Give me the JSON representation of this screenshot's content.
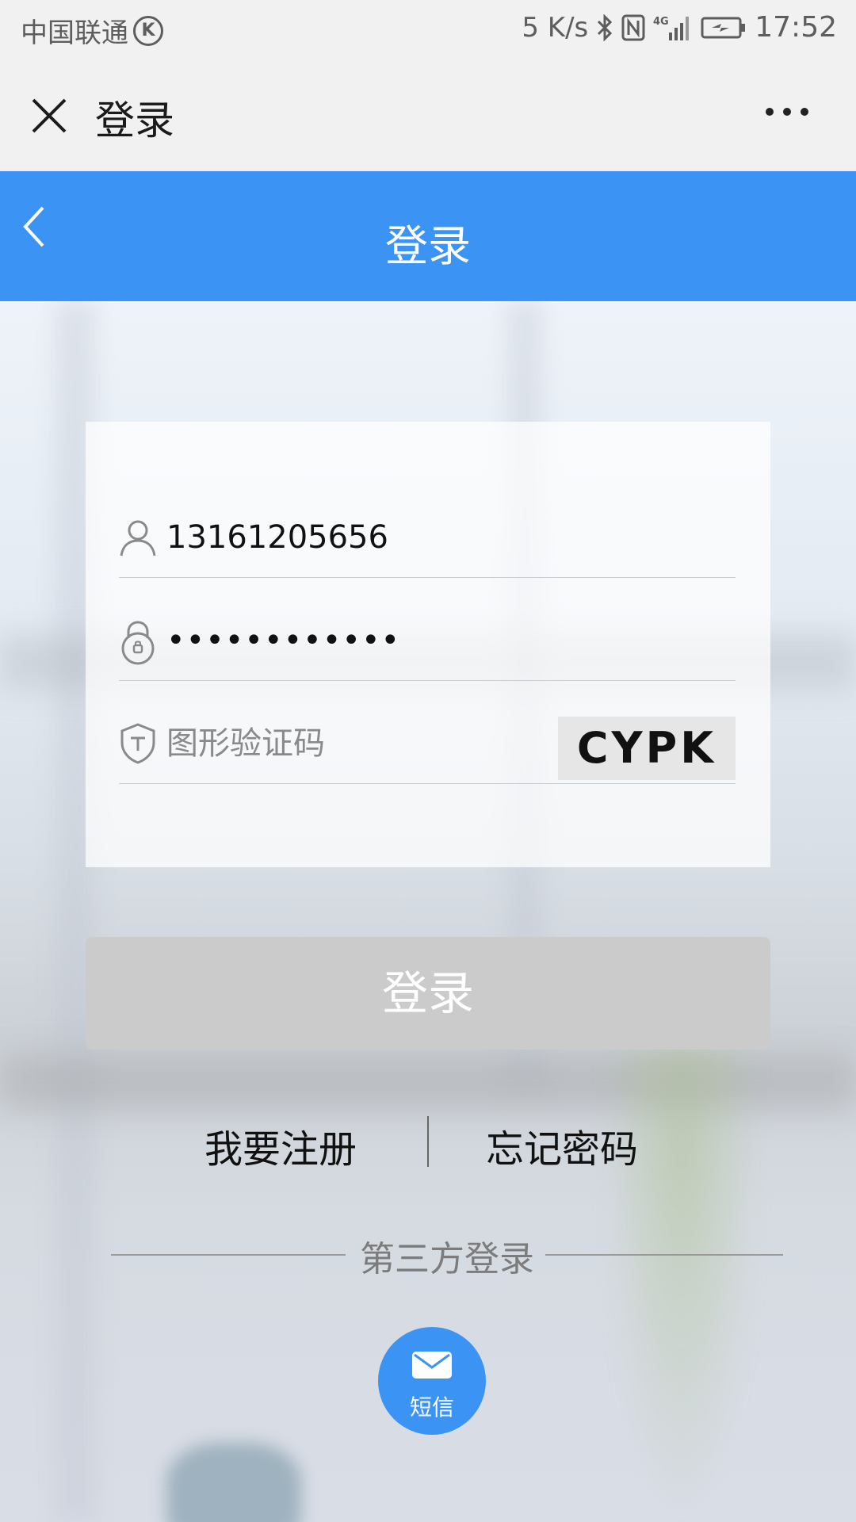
{
  "status_bar": {
    "carrier": "中国联通",
    "carrier_badge": "K",
    "speed": "5 K/s",
    "network": "4G",
    "time": "17:52",
    "icons": [
      "k-badge-icon",
      "bluetooth-icon",
      "nfc-icon",
      "signal-icon",
      "battery-charging-icon"
    ]
  },
  "nav": {
    "title": "登录",
    "close_icon": "close-icon",
    "more_icon": "more-dots-icon"
  },
  "header": {
    "title": "登录",
    "back_icon": "chevron-left-icon",
    "color": "#3b94f3"
  },
  "form": {
    "phone": {
      "value": "13161205656",
      "icon": "user-icon"
    },
    "password": {
      "value": "••••••••••••",
      "icon": "lock-icon"
    },
    "captcha": {
      "placeholder": "图形验证码",
      "icon": "shield-icon",
      "image_text": "CYPK"
    }
  },
  "login_button": {
    "label": "登录",
    "color": "#cbcbcb"
  },
  "links": {
    "register": "我要注册",
    "forgot": "忘记密码"
  },
  "third_party": {
    "label": "第三方登录",
    "sms": {
      "label": "短信",
      "icon": "envelope-icon"
    }
  }
}
